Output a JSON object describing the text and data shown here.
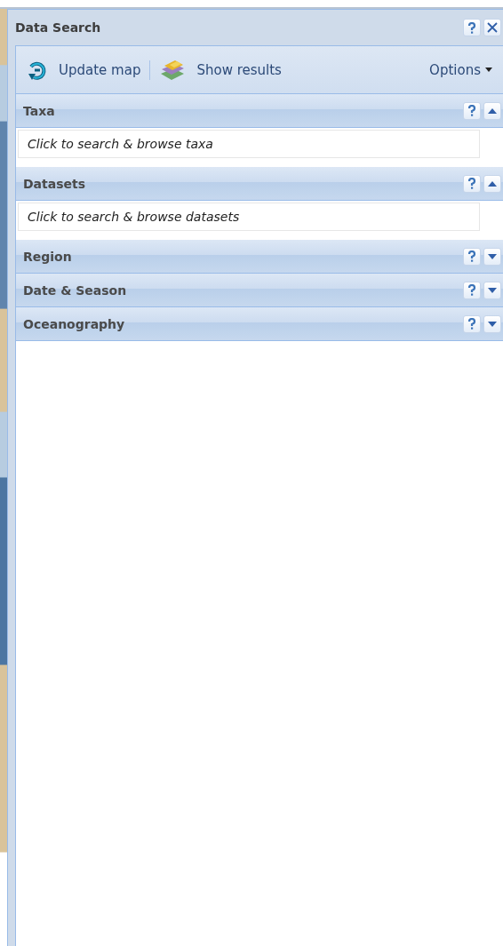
{
  "window": {
    "title": "Data Search"
  },
  "toolbar": {
    "buttons": [
      {
        "label": "Update map"
      },
      {
        "label": "Show results"
      }
    ],
    "menu": "Options"
  },
  "sections": [
    {
      "title": "Taxa",
      "expanded": true,
      "prompt": "Click to search & browse taxa"
    },
    {
      "title": "Datasets",
      "expanded": true,
      "prompt": "Click to search & browse datasets"
    },
    {
      "title": "Region",
      "expanded": false
    },
    {
      "title": "Date & Season",
      "expanded": false
    },
    {
      "title": "Oceanography",
      "expanded": false
    }
  ]
}
